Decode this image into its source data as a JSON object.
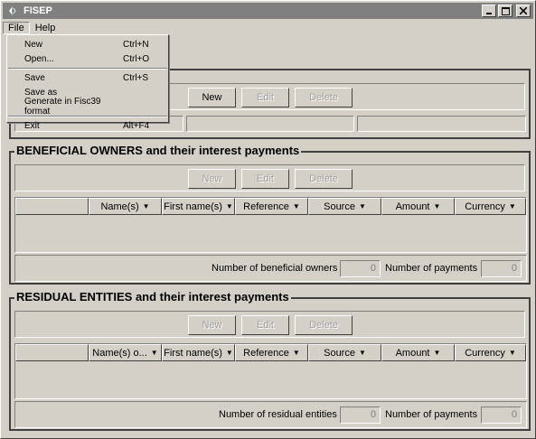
{
  "window": {
    "title": "FISEP",
    "icon": "java-cup-icon"
  },
  "menubar": {
    "items": [
      "File",
      "Help"
    ]
  },
  "file_menu": {
    "items": [
      {
        "label": "New",
        "accel": "Ctrl+N"
      },
      {
        "label": "Open...",
        "accel": "Ctrl+O"
      },
      {
        "label": "Save",
        "accel": "Ctrl+S"
      },
      {
        "label": "Save as",
        "accel": ""
      },
      {
        "label": "Generate in Fisc39 format",
        "accel": ""
      },
      {
        "label": "Exit",
        "accel": "Alt+F4"
      }
    ]
  },
  "paying_agent": {
    "buttons": {
      "new": "New",
      "edit": "Edit",
      "delete": "Delete"
    }
  },
  "beneficial_owners": {
    "title": "BENEFICIAL OWNERS and their interest payments",
    "buttons": {
      "new": "New",
      "edit": "Edit",
      "delete": "Delete"
    },
    "columns": [
      "",
      "Name(s)",
      "First name(s)",
      "Reference",
      "Source",
      "Amount",
      "Currency"
    ],
    "count_label": "Number of beneficial owners",
    "count_value": "0",
    "payments_label": "Number of payments",
    "payments_value": "0"
  },
  "residual_entities": {
    "title": "RESIDUAL ENTITIES and their interest payments",
    "buttons": {
      "new": "New",
      "edit": "Edit",
      "delete": "Delete"
    },
    "columns": [
      "",
      "Name(s) o...",
      "First name(s)",
      "Reference",
      "Source",
      "Amount",
      "Currency"
    ],
    "count_label": "Number of residual entities",
    "count_value": "0",
    "payments_label": "Number of payments",
    "payments_value": "0"
  }
}
